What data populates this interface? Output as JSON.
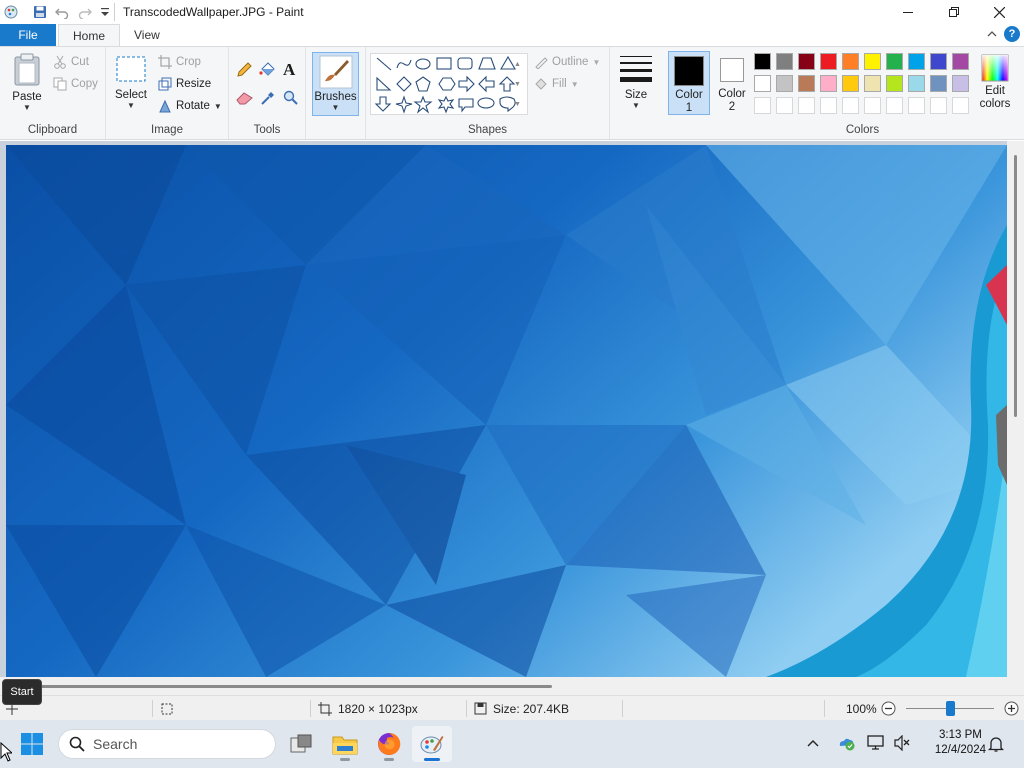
{
  "window": {
    "title": "TranscodedWallpaper.JPG - Paint"
  },
  "tabs": [
    {
      "label": "File"
    },
    {
      "label": "Home"
    },
    {
      "label": "View"
    }
  ],
  "ribbon": {
    "clipboard": {
      "label": "Clipboard",
      "paste": "Paste",
      "cut": "Cut",
      "copy": "Copy"
    },
    "image": {
      "label": "Image",
      "select": "Select",
      "crop": "Crop",
      "resize": "Resize",
      "rotate": "Rotate"
    },
    "tools": {
      "label": "Tools"
    },
    "brushes": {
      "label": "Brushes"
    },
    "shapes": {
      "label": "Shapes",
      "outline": "Outline",
      "fill": "Fill"
    },
    "size": {
      "label": "Size"
    },
    "color1": {
      "label_line1": "Color",
      "label_line2": "1",
      "value": "#000000"
    },
    "color2": {
      "label_line1": "Color",
      "label_line2": "2",
      "value": "#ffffff"
    },
    "colors": {
      "label": "Colors",
      "row1": [
        "#000000",
        "#7f7f7f",
        "#880015",
        "#ed1c24",
        "#ff7f27",
        "#fff200",
        "#22b14c",
        "#00a2e8",
        "#3f48cc",
        "#a349a4"
      ],
      "row2": [
        "#ffffff",
        "#c3c3c3",
        "#b97a57",
        "#ffaec9",
        "#ffc90e",
        "#efe4b0",
        "#b5e61d",
        "#99d9ea",
        "#7092be",
        "#c8bfe7"
      ]
    },
    "edit_colors": {
      "line1": "Edit",
      "line2": "colors"
    }
  },
  "statusbar": {
    "dimensions": "1820 × 1023px",
    "size": "Size: 207.4KB",
    "zoom": "100%"
  },
  "tooltip": {
    "text": "Start"
  },
  "taskbar": {
    "search_placeholder": "Search",
    "time": "3:13 PM",
    "date": "12/4/2024"
  }
}
